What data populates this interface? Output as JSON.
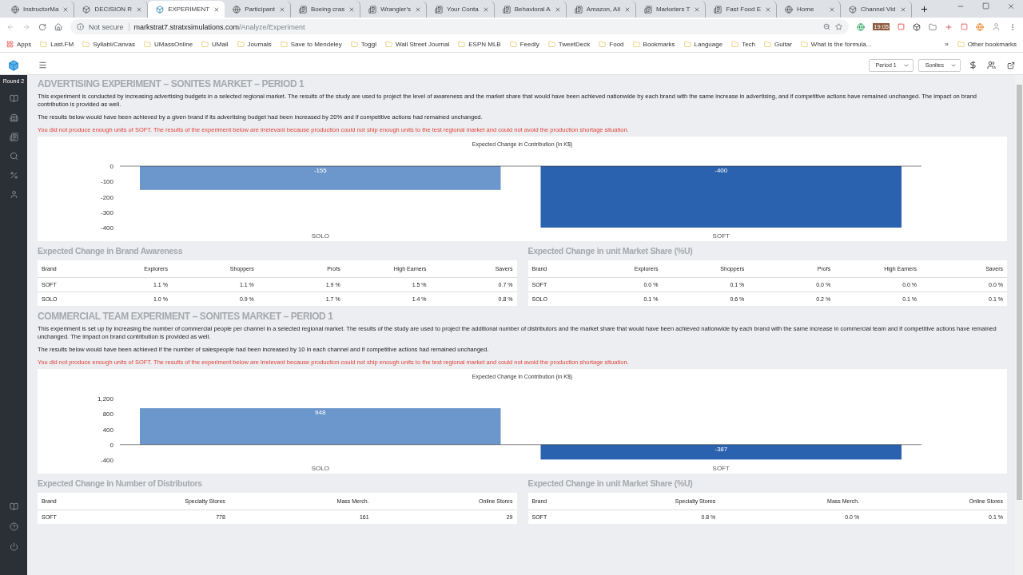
{
  "browser": {
    "tabs": [
      {
        "title": "InstructorMa",
        "selected": false
      },
      {
        "title": "DECISION R",
        "selected": false
      },
      {
        "title": "EXPERIMENT",
        "selected": true
      },
      {
        "title": "Participant",
        "selected": false
      },
      {
        "title": "Boeing cras",
        "selected": false
      },
      {
        "title": "Wrangler's",
        "selected": false
      },
      {
        "title": "Your Conta",
        "selected": false
      },
      {
        "title": "Behavioral A",
        "selected": false
      },
      {
        "title": "Amazon, Ali",
        "selected": false
      },
      {
        "title": "Marketers T",
        "selected": false
      },
      {
        "title": "Fast Food E",
        "selected": false
      },
      {
        "title": "Home",
        "selected": false
      },
      {
        "title": "Channel Vid",
        "selected": false
      }
    ],
    "security": "Not secure",
    "url_host": "markstrat7.stratxsimulations.com",
    "url_path": "/Analyze/Experiment",
    "extension_badge": "19:05",
    "bookmarks": [
      "Apps",
      "Last.FM",
      "Syllabi/Canvas",
      "UMassOnline",
      "UMail",
      "Journals",
      "Save to Mendeley",
      "Toggl",
      "Wall Street Journal",
      "ESPN MLB",
      "Feedly",
      "TweetDeck",
      "Food",
      "Bookmarks",
      "Language",
      "Tech",
      "Guitar",
      "What is the formula..."
    ],
    "more_bookmarks": "»",
    "other_bookmarks": "Other bookmarks"
  },
  "app": {
    "round": "Round 2",
    "period": "Period 1",
    "market": "Sonites"
  },
  "sections": [
    {
      "title": "ADVERTISING EXPERIMENT – SONITES MARKET – PERIOD 1",
      "intro": "This experiment is conducted by increasing advertising budgets in a selected regional market. The results of the study are used to project the level of awareness and the market share that would have been achieved nationwide by each brand with the same increase in advertising, and if competitive actions have remained unchanged. The impact on brand contribution is provided as well.",
      "condition": "The results below would have been achieved by a given brand if its advertising budget had been increased by 20% and if competitive actions had remained unchanged.",
      "warning": "You did not produce enough units of SOFT. The results of the experiment below are irrelevant because production could not ship enough units to the test regional market and could not avoid the production shortage situation.",
      "chart_data": {
        "type": "bar",
        "title": "Expected Change in Contribution (in K$)",
        "categories": [
          "SOLO",
          "SOFT"
        ],
        "values": [
          -155,
          -400
        ],
        "ylim": [
          -400,
          0
        ],
        "yticks": [
          0,
          -100,
          -200,
          -300,
          -400
        ],
        "data_labels": true
      },
      "tables": [
        {
          "title": "Expected Change in Brand Awareness",
          "columns": [
            "Brand",
            "Explorers",
            "Shoppers",
            "Profs",
            "High Earners",
            "Savers"
          ],
          "rows": [
            [
              "SOFT",
              "1.1 %",
              "1.1 %",
              "1.9 %",
              "1.5 %",
              "0.7 %"
            ],
            [
              "SOLO",
              "1.0 %",
              "0.9 %",
              "1.7 %",
              "1.4 %",
              "0.8 %"
            ]
          ]
        },
        {
          "title": "Expected Change in unit Market Share (%U)",
          "columns": [
            "Brand",
            "Explorers",
            "Shoppers",
            "Profs",
            "High Earners",
            "Savers"
          ],
          "rows": [
            [
              "SOFT",
              "0.0 %",
              "0.1 %",
              "0.0 %",
              "0.0 %",
              "0.0 %"
            ],
            [
              "SOLO",
              "0.1 %",
              "0.6 %",
              "0.2 %",
              "0.1 %",
              "0.1 %"
            ]
          ]
        }
      ]
    },
    {
      "title": "COMMERCIAL TEAM EXPERIMENT – SONITES MARKET – PERIOD 1",
      "intro": "This experiment is set up by increasing the number of commercial people per channel in a selected regional market. The results of the study are used to project the additional number of distributors and the market share that would have been achieved nationwide by each brand with the same increase in commercial team and if competitive actions have remained unchanged. The impact on brand contribution is provided as well.",
      "condition": "The results below would have been achieved if the number of salespeople had been increased by 10 in each channel and if competitive actions had remained unchanged.",
      "warning": "You did not produce enough units of SOFT. The results of the experiment below are irrelevant because production could not ship enough units to the test regional market and could not avoid the production shortage situation.",
      "chart_data": {
        "type": "bar",
        "title": "Expected Change in Contribution (in K$)",
        "categories": [
          "SOLO",
          "SOFT"
        ],
        "values": [
          948,
          -387
        ],
        "ylim": [
          -400,
          1200
        ],
        "yticks": [
          {
            "value": 1200,
            "label": "1,200"
          },
          800,
          400,
          0,
          -400
        ],
        "data_labels": true
      },
      "tables": [
        {
          "title": "Expected Change in Number of Distributors",
          "columns": [
            "Brand",
            "Specialty Stores",
            "Mass Merch.",
            "Online Stores"
          ],
          "rows": [
            [
              "SOFT",
              "778",
              "161",
              "29"
            ]
          ]
        },
        {
          "title": "Expected Change in unit Market Share (%U)",
          "columns": [
            "Brand",
            "Specialty Stores",
            "Mass Merch.",
            "Online Stores"
          ],
          "rows": [
            [
              "SOFT",
              "0.8 %",
              "0.0 %",
              "0.1 %"
            ]
          ]
        }
      ]
    }
  ]
}
